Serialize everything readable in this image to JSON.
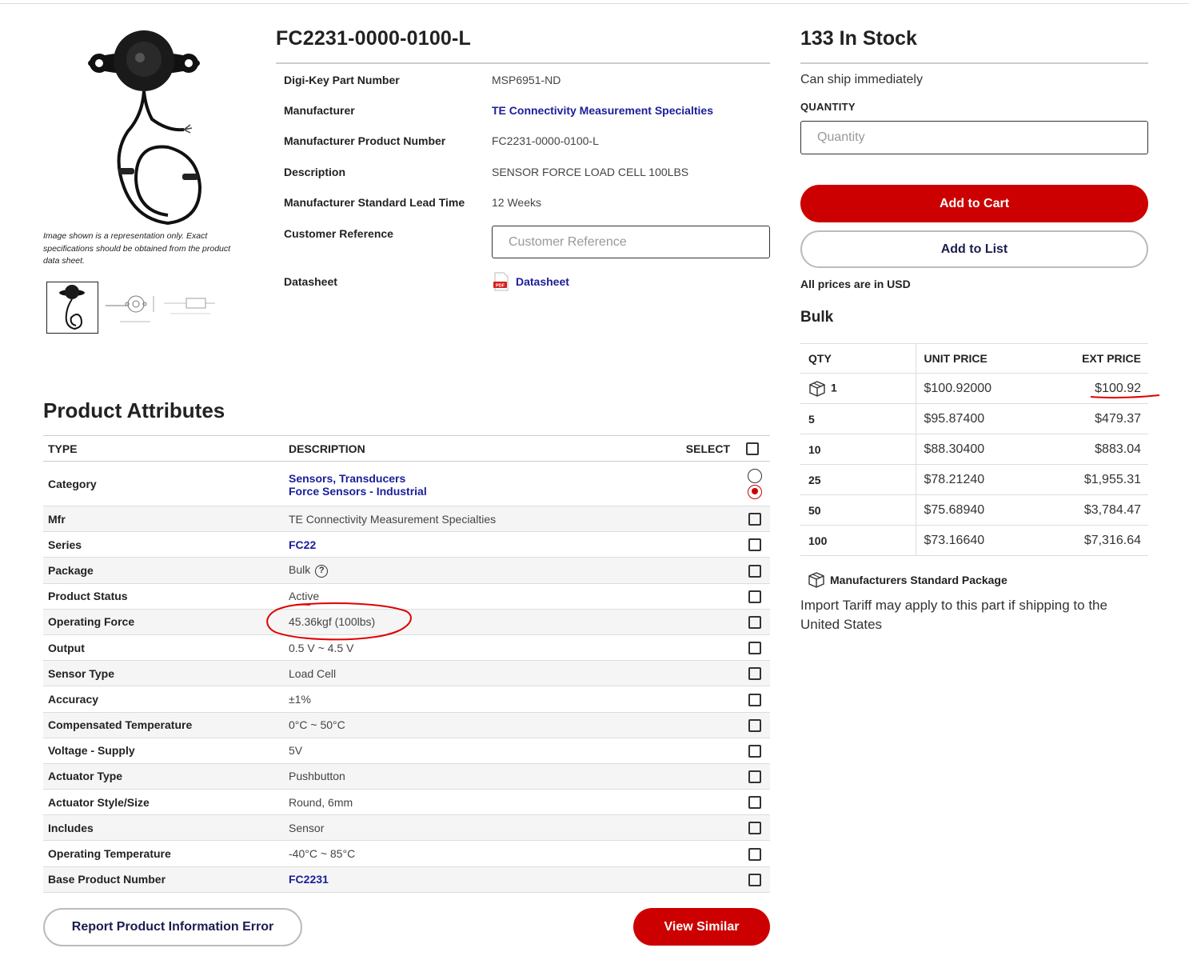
{
  "product": {
    "image_note": "Image shown is a representation only. Exact specifications should be obtained from the product data sheet.",
    "part_title": "FC2231-0000-0100-L",
    "details": [
      {
        "label": "Digi-Key Part Number",
        "value": "MSP6951-ND"
      },
      {
        "label": "Manufacturer",
        "value": "TE Connectivity Measurement Specialties"
      },
      {
        "label": "Manufacturer Product Number",
        "value": "FC2231-0000-0100-L"
      },
      {
        "label": "Description",
        "value": "SENSOR FORCE LOAD CELL 100LBS"
      },
      {
        "label": "Manufacturer Standard Lead Time",
        "value": "12 Weeks"
      },
      {
        "label": "Customer Reference",
        "placeholder": "Customer Reference"
      },
      {
        "label": "Datasheet",
        "value": "Datasheet"
      }
    ]
  },
  "attributes": {
    "title": "Product Attributes",
    "headers": {
      "type": "TYPE",
      "description": "DESCRIPTION",
      "select": "SELECT"
    },
    "category": {
      "label": "Category",
      "line1": "Sensors, Transducers",
      "line2": "Force Sensors - Industrial"
    },
    "rows": [
      {
        "type": "Mfr",
        "desc": "TE Connectivity Measurement Specialties"
      },
      {
        "type": "Series",
        "desc": "FC22"
      },
      {
        "type": "Package",
        "desc": "Bulk"
      },
      {
        "type": "Product Status",
        "desc": "Active"
      },
      {
        "type": "Operating Force",
        "desc": "45.36kgf (100lbs)"
      },
      {
        "type": "Output",
        "desc": "0.5 V ~ 4.5 V"
      },
      {
        "type": "Sensor Type",
        "desc": "Load Cell"
      },
      {
        "type": "Accuracy",
        "desc": "±1%"
      },
      {
        "type": "Compensated Temperature",
        "desc": "0°C ~ 50°C"
      },
      {
        "type": "Voltage - Supply",
        "desc": "5V"
      },
      {
        "type": "Actuator Type",
        "desc": "Pushbutton"
      },
      {
        "type": "Actuator Style/Size",
        "desc": "Round, 6mm"
      },
      {
        "type": "Includes",
        "desc": "Sensor"
      },
      {
        "type": "Operating Temperature",
        "desc": "-40°C ~ 85°C"
      },
      {
        "type": "Base Product Number",
        "desc": "FC2231"
      }
    ],
    "report_button": "Report Product Information Error",
    "similar_button": "View Similar"
  },
  "purchase": {
    "stock": "133 In Stock",
    "ship_note": "Can ship immediately",
    "qty_label": "QUANTITY",
    "qty_placeholder": "Quantity",
    "add_cart": "Add to Cart",
    "add_list": "Add to List",
    "currency_note": "All prices are in USD",
    "packaging": "Bulk",
    "price_headers": {
      "qty": "QTY",
      "unit": "UNIT PRICE",
      "ext": "EXT PRICE"
    },
    "price_breaks": [
      {
        "qty": "1",
        "unit": "$100.92000",
        "ext": "$100.92"
      },
      {
        "qty": "5",
        "unit": "$95.87400",
        "ext": "$479.37"
      },
      {
        "qty": "10",
        "unit": "$88.30400",
        "ext": "$883.04"
      },
      {
        "qty": "25",
        "unit": "$78.21240",
        "ext": "$1,955.31"
      },
      {
        "qty": "50",
        "unit": "$75.68940",
        "ext": "$3,784.47"
      },
      {
        "qty": "100",
        "unit": "$73.16640",
        "ext": "$7,316.64"
      }
    ],
    "msp_label": "Manufacturers Standard Package",
    "tariff_note": "Import Tariff may apply to this part if shipping to the United States"
  },
  "colors": {
    "brand_red": "#cc0000",
    "link_blue": "#1b1d99",
    "annotation_red": "#e00000"
  }
}
